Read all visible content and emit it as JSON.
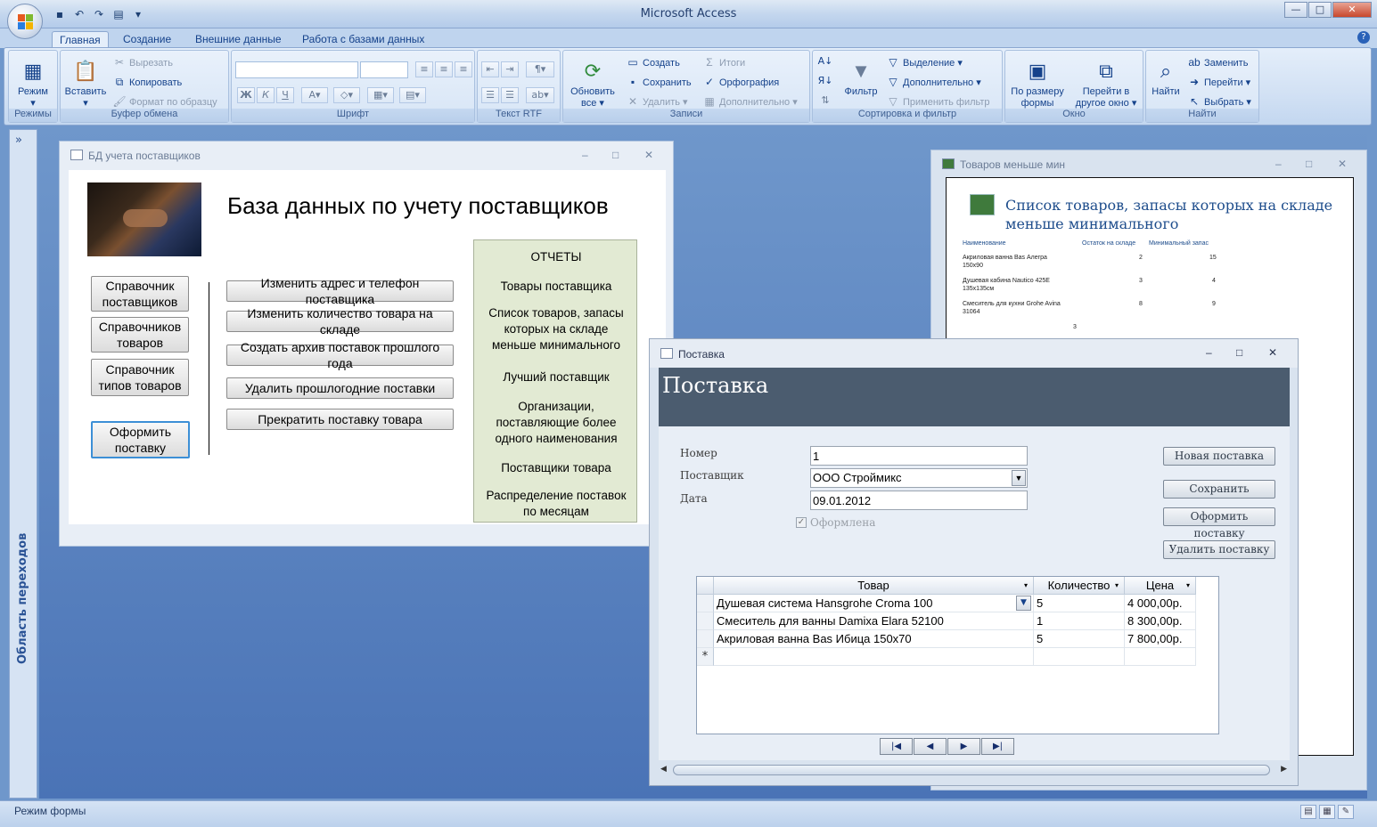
{
  "app": {
    "title": "Microsoft Access",
    "qat_icons": [
      "save-icon",
      "undo-icon",
      "redo-icon",
      "document-icon",
      "customize-icon"
    ]
  },
  "ribbon": {
    "tabs": [
      "Главная",
      "Создание",
      "Внешние данные",
      "Работа с базами данных"
    ],
    "active_tab": "Главная",
    "groups": {
      "views": {
        "label": "Режимы",
        "mode": "Режим"
      },
      "clipboard": {
        "label": "Буфер обмена",
        "paste": "Вставить",
        "cut": "Вырезать",
        "copy": "Копировать",
        "format_painter": "Формат по образцу"
      },
      "font": {
        "label": "Шрифт"
      },
      "rtf": {
        "label": "Текст RTF"
      },
      "records": {
        "label": "Записи",
        "refresh": "Обновить все",
        "new": "Создать",
        "save": "Сохранить",
        "delete": "Удалить",
        "totals": "Итоги",
        "spelling": "Орфография",
        "more": "Дополнительно"
      },
      "sort_filter": {
        "label": "Сортировка и фильтр",
        "filter": "Фильтр",
        "selection": "Выделение",
        "advanced": "Дополнительно",
        "toggle_filter": "Применить фильтр"
      },
      "window": {
        "label": "Окно",
        "fit": "По размеру формы",
        "switch": "Перейти в другое окно"
      },
      "find": {
        "label": "Найти",
        "find": "Найти",
        "replace": "Заменить",
        "goto": "Перейти",
        "select": "Выбрать"
      }
    }
  },
  "nav_pane": {
    "label": "Область переходов",
    "toggle": "»"
  },
  "main_form": {
    "window_title": "БД учета поставщиков",
    "heading": "База данных по учету поставщиков",
    "left_buttons": [
      "Справочник поставщиков",
      "Справочников товаров",
      "Справочник типов товаров",
      "Оформить поставку"
    ],
    "middle_buttons": [
      "Изменить адрес и телефон поставщика",
      "Изменить количество товара на складе",
      "Создать архив поставок прошлого года",
      "Удалить прошлогодние поставки",
      "Прекратить поставку товара"
    ],
    "reports": {
      "title": "ОТЧЕТЫ",
      "items": [
        "Товары поставщика",
        "Список товаров, запасы которых на складе меньше минимального",
        "Лучший поставщик",
        "Организации, поставляющие более одного наименования",
        "Поставщики товара",
        "Распределение поставок по месяцам"
      ]
    }
  },
  "report_window": {
    "window_title": "Товаров меньше мин",
    "title_line1": "Список товаров, запасы которых на складе",
    "title_line2": "меньше минимального",
    "columns": [
      "Наименование",
      "Остаток на складе",
      "Минимальный запас"
    ],
    "rows": [
      {
        "name1": "Акриловая ванна Bas Алегра",
        "name2": "150х90",
        "stock": "2",
        "min": "15"
      },
      {
        "name1": "Душевая кабина Nautico 425E",
        "name2": "135х135см",
        "stock": "3",
        "min": "4"
      },
      {
        "name1": "Смеситель для кухни Grohe Avina",
        "name2": "31064",
        "stock": "8",
        "min": "9"
      }
    ],
    "footer_num": "3"
  },
  "postavka": {
    "window_title": "Поставка",
    "header": "Поставка",
    "fields": {
      "number_label": "Номер",
      "number_value": "1",
      "supplier_label": "Поставщик",
      "supplier_value": "ООО Строймикс",
      "date_label": "Дата",
      "date_value": "09.01.2012",
      "done_label": "Оформлена",
      "done_checked": true
    },
    "buttons": [
      "Новая поставка",
      "Сохранить",
      "Оформить поставку",
      "Удалить поставку"
    ],
    "grid": {
      "columns": [
        "Товар",
        "Количество",
        "Цена"
      ],
      "rows": [
        {
          "product": "Душевая система Hansgrohe Croma 100",
          "qty": "5",
          "price": "4 000,00р."
        },
        {
          "product": "Смеситель для ванны Damixa Elara 52100",
          "qty": "1",
          "price": "8 300,00р."
        },
        {
          "product": "Акриловая ванна Bas Ибица 150х70",
          "qty": "5",
          "price": "7 800,00р."
        }
      ],
      "new_row_marker": "*"
    }
  },
  "status_bar": {
    "text": "Режим формы"
  }
}
